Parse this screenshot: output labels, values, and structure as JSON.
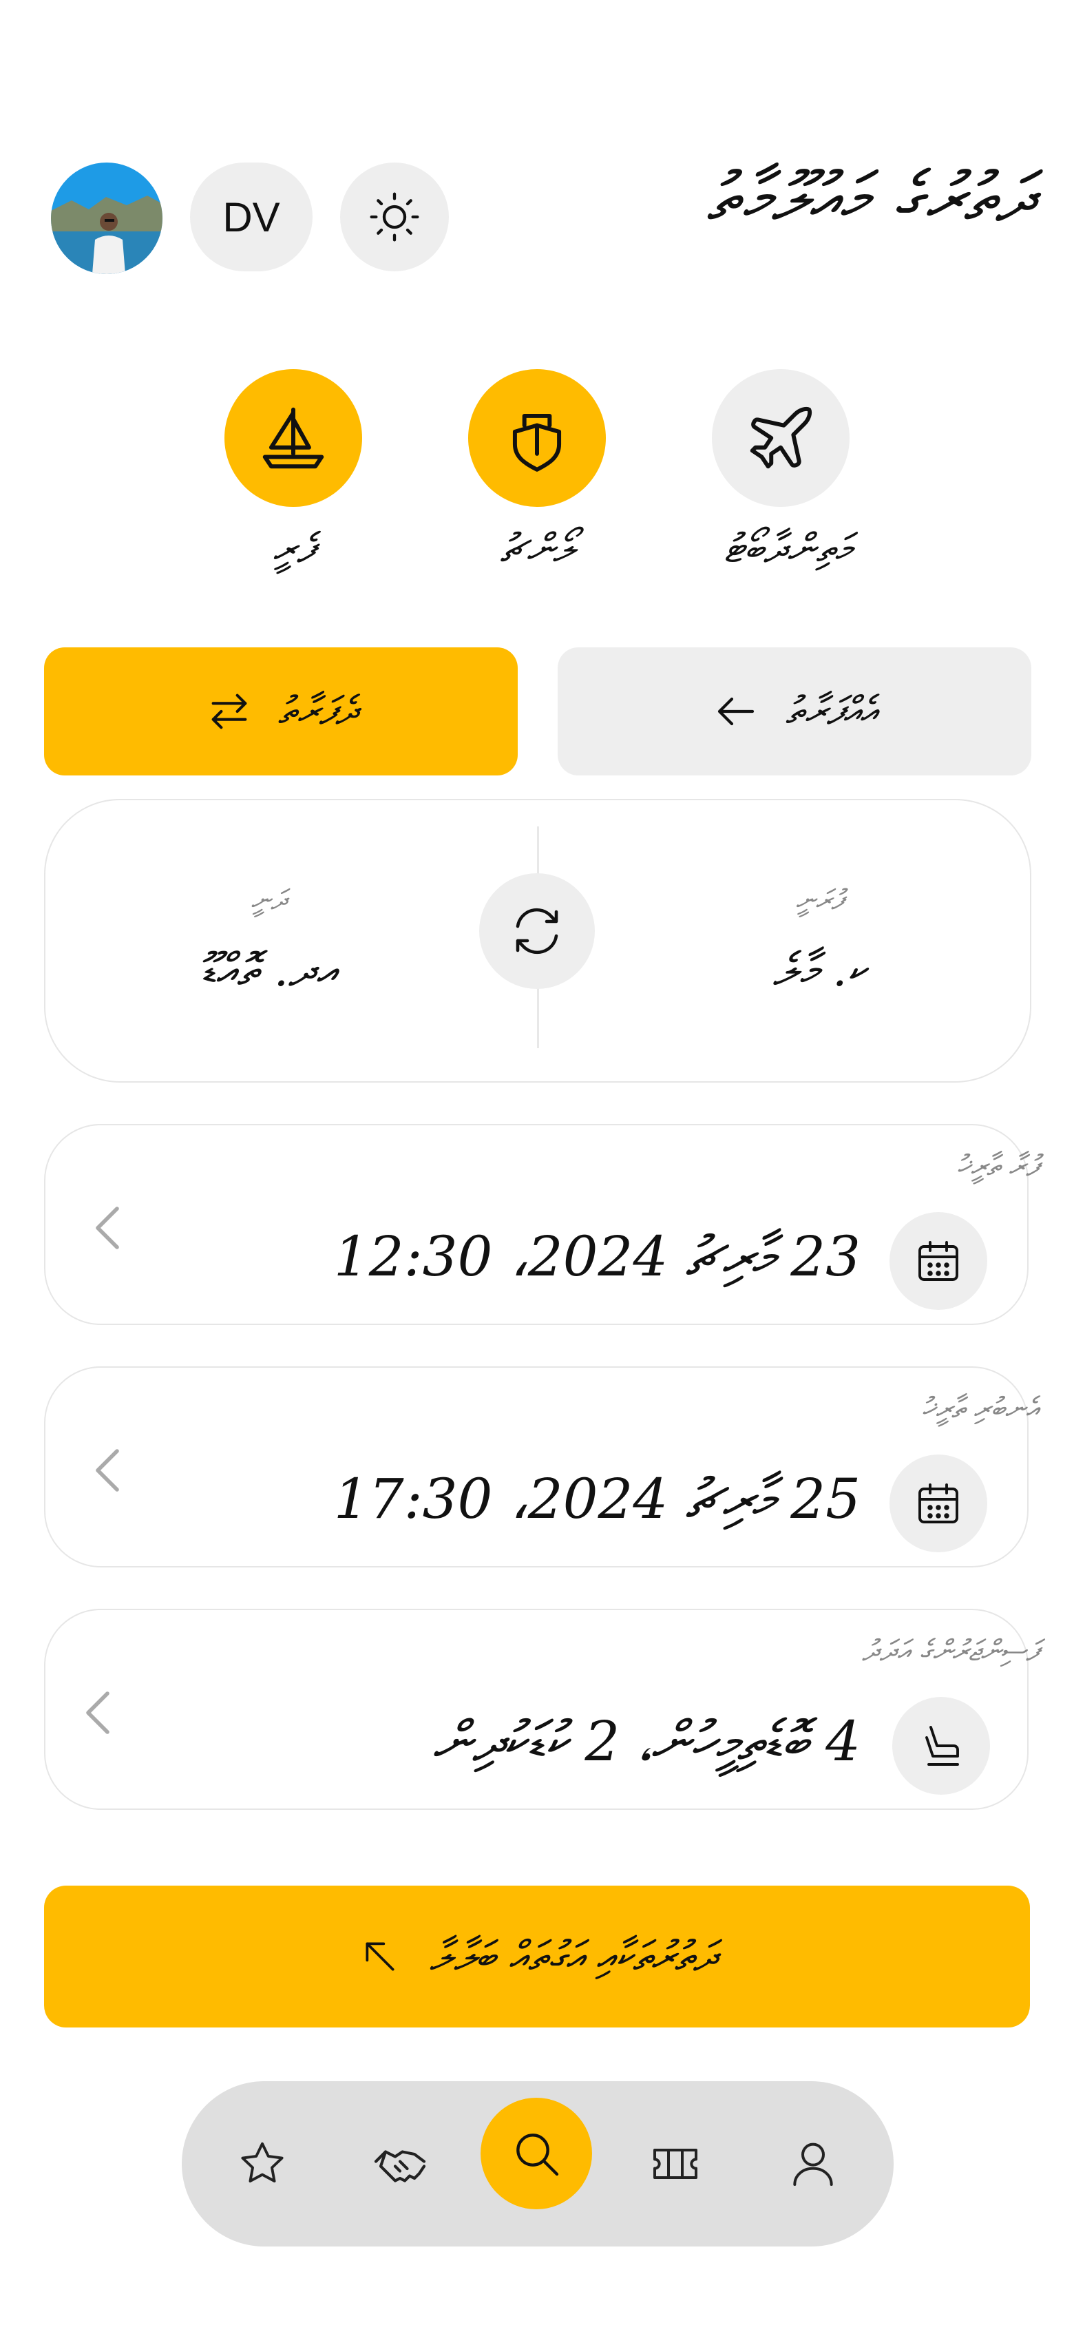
{
  "header": {
    "title": "ދަތުރުގެ މައުލޫމާތު",
    "language": "DV"
  },
  "modes": [
    {
      "label": "ފެރީ",
      "icon": "sailboat-icon",
      "active": true
    },
    {
      "label": "ލޯންޗު",
      "icon": "ship-icon",
      "active": true
    },
    {
      "label": "މަތިންދާބޯޓު",
      "icon": "airplane-icon",
      "active": false
    }
  ],
  "trip_type": {
    "round_trip": "ދެފަރާތު",
    "one_way": "އެއްފަރާތު"
  },
  "route": {
    "to_label": "ދަނީ",
    "to_value": "އދ. ތޮއްޑޫ",
    "from_label": "ފުރަނީ",
    "from_value": "ކ. މާލެ"
  },
  "departure": {
    "label": "ފުރާ ތާރީޚު",
    "value": "23 މާރިޗު 2024، 12:30"
  },
  "return": {
    "label": "އެނބުރި ތާރީޚު",
    "value": "25 މާރިޗު 2024، 17:30"
  },
  "passengers": {
    "label": "ފަސިންޖަރުންގެ އަދަދު",
    "value": "4 ބޮޑެތިމީހުން، 2 ކުޑަކުދިން"
  },
  "search_button": {
    "label": "ދަތުރުތަކާއި އަގުތައް ބަލާލާ"
  },
  "nav": [
    {
      "icon": "star-icon"
    },
    {
      "icon": "handshake-icon"
    },
    {
      "icon": "search-icon",
      "active": true
    },
    {
      "icon": "ticket-icon"
    },
    {
      "icon": "user-icon"
    }
  ],
  "colors": {
    "accent": "#ffbb00",
    "muted_bg": "#eeeeee",
    "nav_bg": "#dfdfdf"
  }
}
